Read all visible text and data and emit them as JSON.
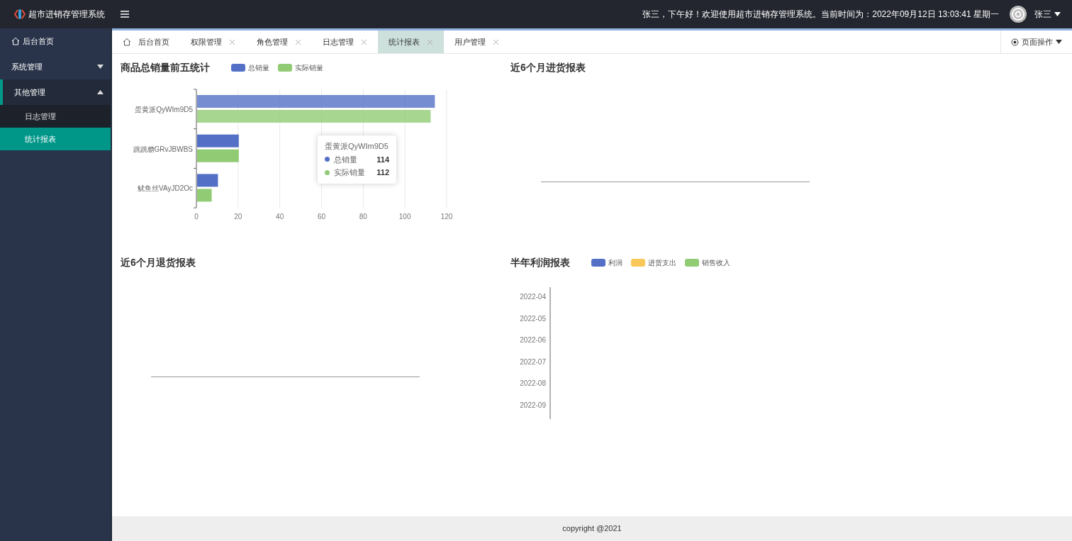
{
  "header": {
    "app_title": "超市进销存管理系统",
    "greeting": "张三，下午好！欢迎使用超市进销存管理系统。当前时间为：2022年09月12日 13:03:41 星期一",
    "user": "张三"
  },
  "sidebar": {
    "items": [
      {
        "label": "后台首页",
        "kind": "link",
        "expanded": false,
        "selected": false
      },
      {
        "label": "系统管理",
        "kind": "group",
        "expanded": false,
        "selected": false
      },
      {
        "label": "其他管理",
        "kind": "group",
        "expanded": true,
        "selected": false,
        "children": [
          {
            "label": "日志管理",
            "selected": false
          },
          {
            "label": "统计报表",
            "selected": true
          }
        ]
      }
    ]
  },
  "tabs": [
    {
      "label": "后台首页",
      "closable": false,
      "selected": false
    },
    {
      "label": "权限管理",
      "closable": true,
      "selected": false
    },
    {
      "label": "角色管理",
      "closable": true,
      "selected": false
    },
    {
      "label": "日志管理",
      "closable": true,
      "selected": false
    },
    {
      "label": "统计报表",
      "closable": true,
      "selected": true
    },
    {
      "label": "用户管理",
      "closable": true,
      "selected": false
    }
  ],
  "page_actions": "页面操作",
  "panels": [
    {
      "title": "商品总销量前五统计",
      "kind": "bar",
      "chart_data": {
        "type": "bar",
        "orientation": "horizontal",
        "categories": [
          "蛋黄派QyWIm9D5",
          "跳跳糖GRvJBWBS",
          "鱿鱼丝VAyJD2Oc"
        ],
        "series": [
          {
            "name": "总销量",
            "color": "#5470c6",
            "values": [
              114,
              20,
              10
            ]
          },
          {
            "name": "实际销量",
            "color": "#91cc75",
            "values": [
              112,
              20,
              7
            ]
          }
        ],
        "xlim": [
          0,
          120
        ],
        "xticks": [
          0,
          20,
          40,
          60,
          80,
          100,
          120
        ],
        "grid": true
      },
      "tooltip": {
        "title": "蛋黄派QyWIm9D5",
        "rows": [
          {
            "name": "总销量",
            "value": "114"
          },
          {
            "name": "实际销量",
            "value": "112"
          }
        ]
      }
    },
    {
      "title": "近6个月进货报表",
      "kind": "empty"
    },
    {
      "title": "近6个月退货报表",
      "kind": "empty"
    },
    {
      "title": "半年利润报表",
      "kind": "months",
      "legend": [
        {
          "name": "利润",
          "color": "#5470c6"
        },
        {
          "name": "进货支出",
          "color": "#fac858"
        },
        {
          "name": "销售收入",
          "color": "#91cc75"
        }
      ],
      "axis_labels": [
        "2022-04",
        "2022-05",
        "2022-06",
        "2022-07",
        "2022-08",
        "2022-09"
      ]
    }
  ],
  "footer": "copyright @2021"
}
